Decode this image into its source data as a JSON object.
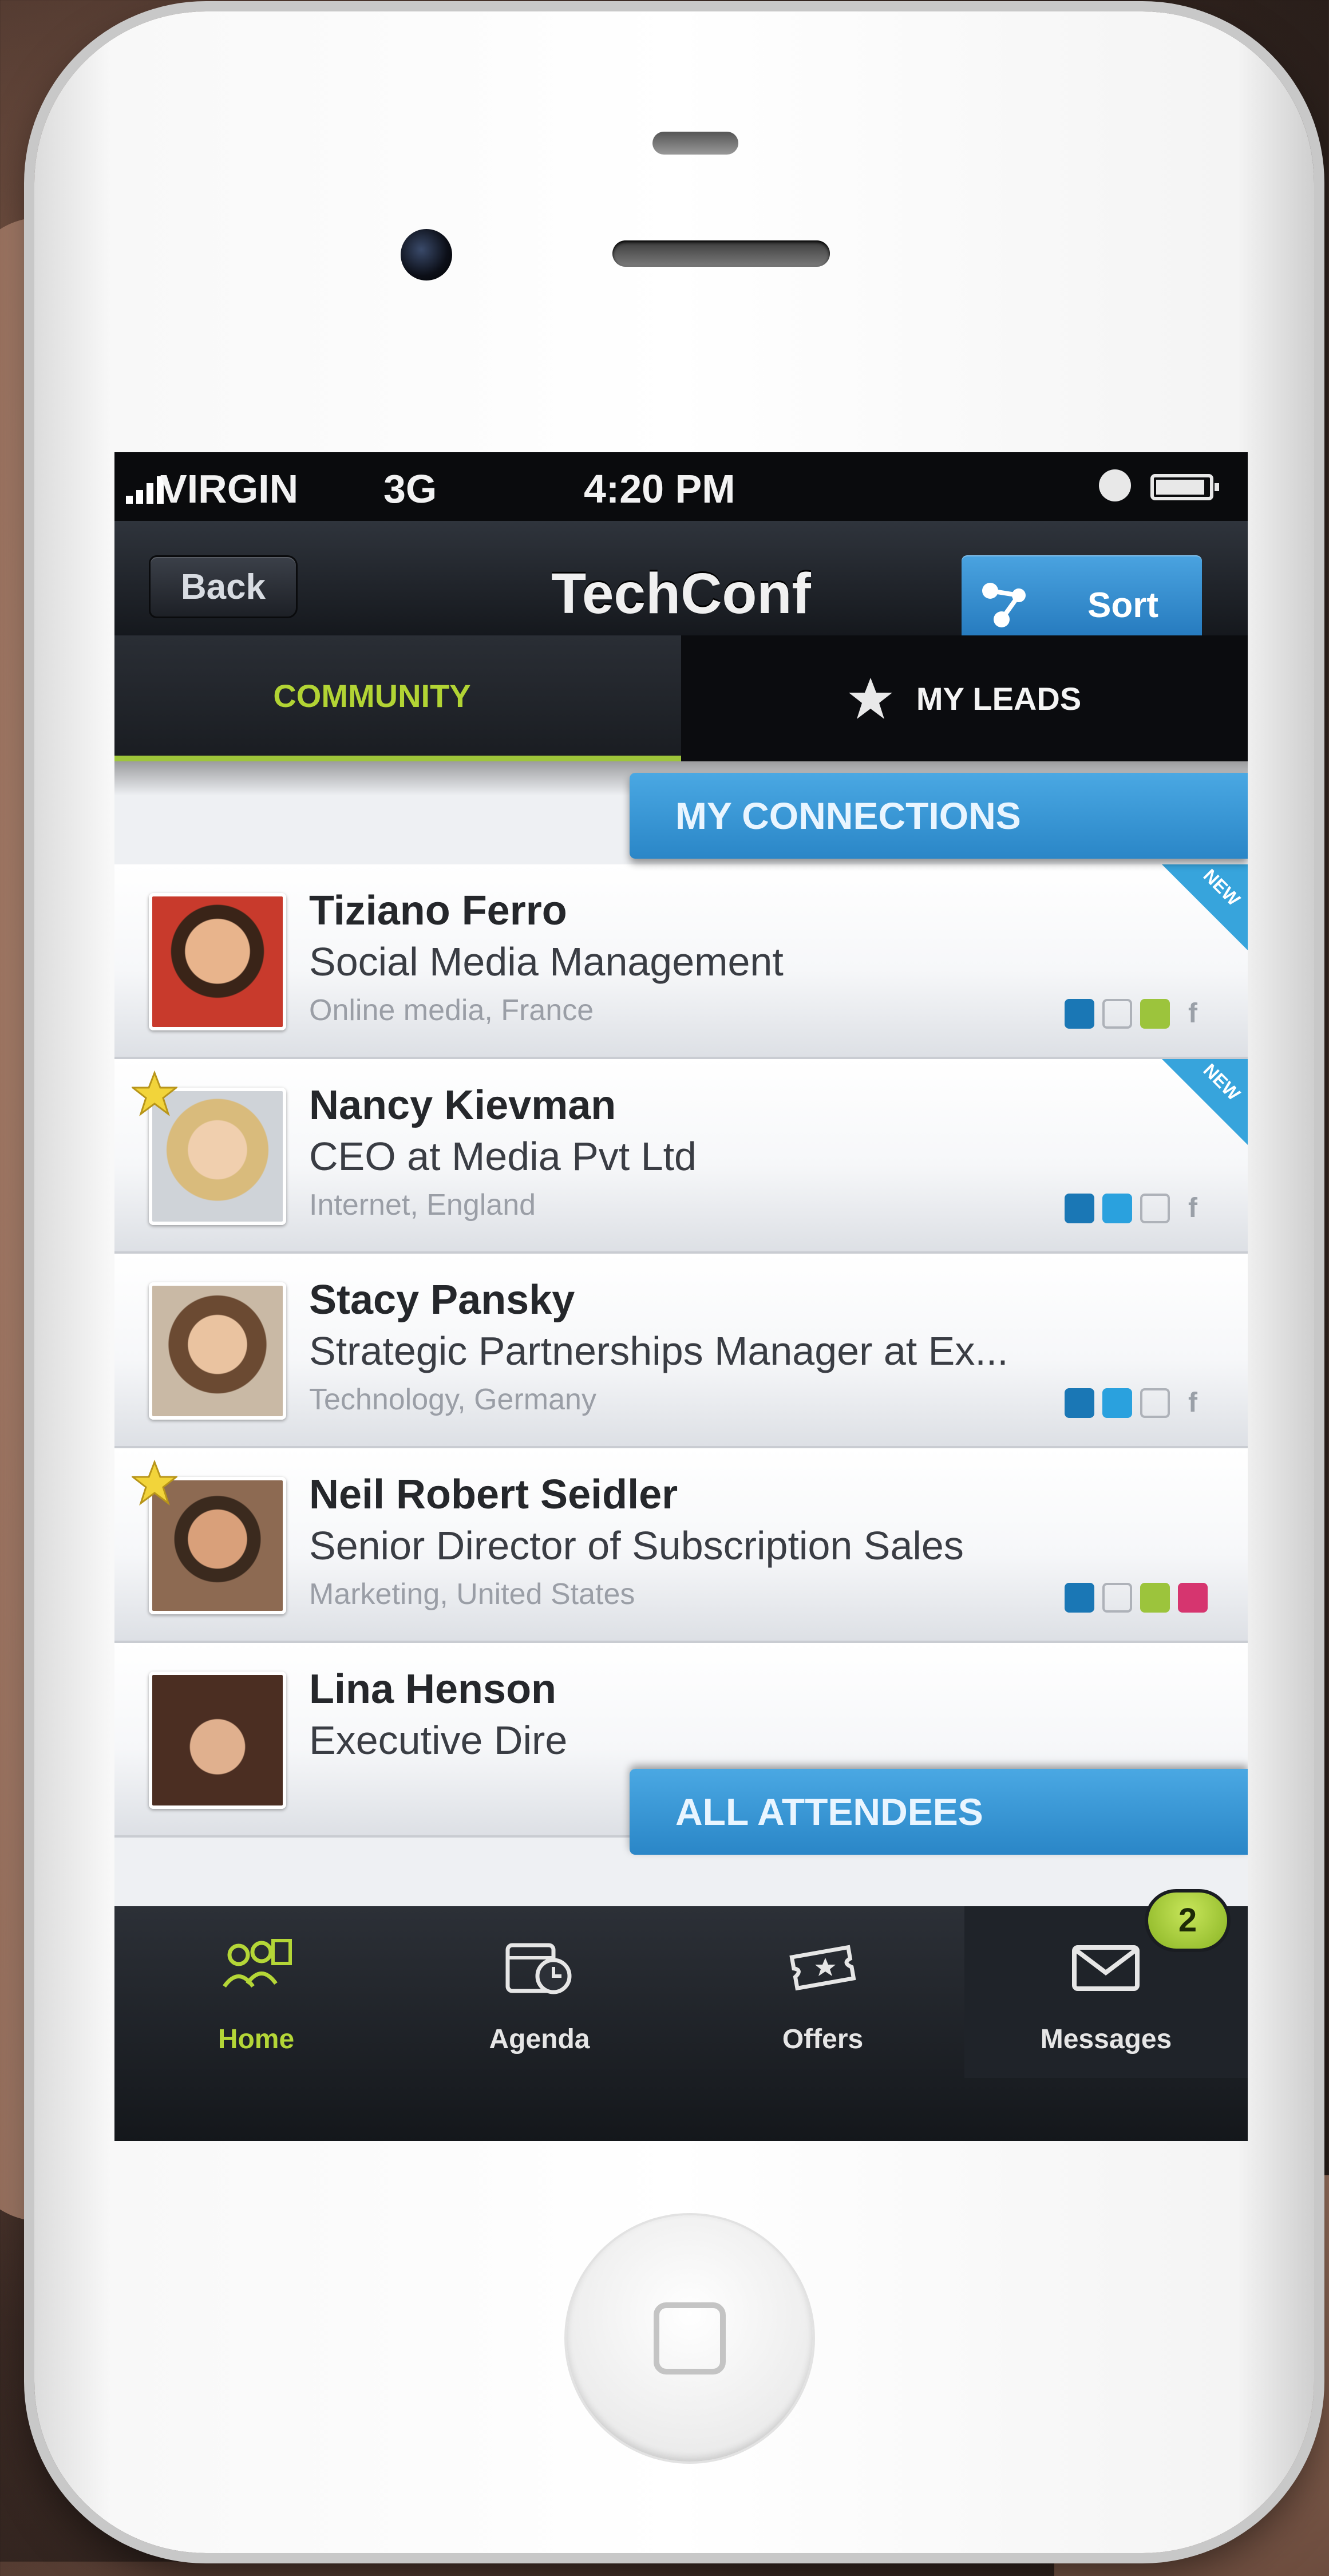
{
  "status_bar": {
    "carrier": "VIRGIN",
    "network": "3G",
    "time": "4:20 PM"
  },
  "nav_bar": {
    "back_label": "Back",
    "title": "TechConf",
    "sort_label": "Sort"
  },
  "top_tabs": [
    {
      "label": "COMMUNITY",
      "active": true
    },
    {
      "label": "MY LEADS",
      "active": false
    }
  ],
  "ribbons": {
    "connections": "MY CONNECTIONS",
    "all": "ALL ATTENDEES"
  },
  "people": [
    {
      "name": "Tiziano Ferro",
      "title": "Social Media Management",
      "location": "Online media, France",
      "badge": "NEW",
      "favorite": false,
      "socials": [
        "li",
        "tw-off",
        "fs-on",
        "fb-off"
      ]
    },
    {
      "name": "Nancy Kievman",
      "title": "CEO at Media Pvt Ltd",
      "location": "Internet, England",
      "badge": "NEW",
      "favorite": true,
      "socials": [
        "li",
        "tw-on",
        "fs-off",
        "fb-off"
      ]
    },
    {
      "name": "Stacy Pansky",
      "title": "Strategic Partnerships Manager at Ex...",
      "location": "Technology, Germany",
      "badge": "",
      "favorite": false,
      "socials": [
        "li",
        "tw-on",
        "fs-off",
        "fb-off"
      ]
    },
    {
      "name": "Neil Robert Seidler",
      "title": "Senior Director of Subscription Sales",
      "location": "Marketing, United States",
      "badge": "",
      "favorite": true,
      "socials": [
        "li",
        "tw-off",
        "fs-on",
        "fb-on"
      ]
    },
    {
      "name": "Lina Henson",
      "title": "Executive Dire",
      "location": "",
      "badge": "",
      "favorite": false,
      "socials": []
    }
  ],
  "bottom_tabs": [
    {
      "label": "Home",
      "icon": "people-icon",
      "active": true
    },
    {
      "label": "Agenda",
      "icon": "calendar-clock-icon",
      "active": false
    },
    {
      "label": "Offers",
      "icon": "ticket-star-icon",
      "active": false
    },
    {
      "label": "Messages",
      "icon": "envelope-icon",
      "active": false
    }
  ],
  "messages_badge": "2",
  "colors": {
    "accent_green": "#b4d637",
    "accent_blue": "#2a86c7",
    "nav_dark": "#15181d"
  }
}
